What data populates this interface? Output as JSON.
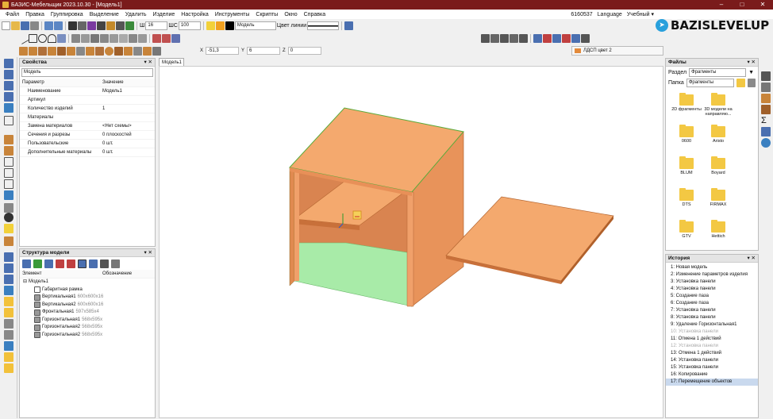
{
  "window": {
    "title": "БАЗИС-Мебельщик 2023.10.30 - [Модель1]",
    "min": "–",
    "max": "□",
    "close": "✕"
  },
  "menu": [
    "Файл",
    "Правка",
    "Группировка",
    "Выделение",
    "Удалить",
    "Изделие",
    "Настройка",
    "Инструменты",
    "Скрипты",
    "Окно",
    "Справка"
  ],
  "menu_right": {
    "id": "6160537",
    "language": "Language",
    "mode": "Учебный ▾"
  },
  "toolbar": {
    "width_label": "Ш",
    "width_value": "16",
    "step_label": "ШС",
    "step_value": "100",
    "layer_value": "Модель",
    "line_color_label": "Цвет линии"
  },
  "brand": {
    "text": "BAZISLEVELUP",
    "tg_icon": "telegram-icon"
  },
  "coords": {
    "x_label": "X",
    "x_value": "-51,3",
    "y_label": "Y",
    "y_value": "6",
    "z_label": "Z",
    "z_value": "0"
  },
  "material": "ЛДСП цвет 2",
  "doc_tab": "Модель1",
  "properties": {
    "title": "Свойства",
    "controls": "▾ ✕",
    "selector": "Модель",
    "col_param": "Параметр",
    "col_value": "Значение",
    "rows": [
      {
        "k": "Наименование",
        "v": "Модель1"
      },
      {
        "k": "Артикул",
        "v": ""
      },
      {
        "k": "Количество изделий",
        "v": "1"
      },
      {
        "k": "Материалы",
        "v": ""
      },
      {
        "k": "Замена материалов",
        "v": "<Нет схемы>"
      },
      {
        "k": "Сечения и разрезы",
        "v": "0 плоскостей"
      },
      {
        "k": "Пользовательские",
        "v": "0 шт."
      },
      {
        "k": "Дополнительные материалы",
        "v": "0 шт."
      }
    ]
  },
  "structure": {
    "title": "Структура модели",
    "controls": "▾ ✕",
    "col_element": "Элемент",
    "col_name": "Обозначение",
    "root": "Модель1",
    "items": [
      {
        "name": "Габаритная рамка",
        "size": ""
      },
      {
        "name": "Вертикальная1",
        "size": "600x600x16"
      },
      {
        "name": "Вертикальная2",
        "size": "600x600x16"
      },
      {
        "name": "Фронтальная1",
        "size": "597x585x4"
      },
      {
        "name": "Горизонтальная1",
        "size": "568x595x"
      },
      {
        "name": "Горизонтальная2",
        "size": "568x595x"
      },
      {
        "name": "Горизонтальная2",
        "size": "568x595x"
      }
    ]
  },
  "files": {
    "title": "Файлы",
    "controls": "▾ ✕",
    "section_label": "Раздел",
    "section_value": "Фрагменты",
    "folder_label": "Папка",
    "folder_value": "Фрагменты",
    "folders": [
      "2D фрагменты",
      "3D модели на направляю...",
      "0600",
      "Aristo",
      "BLUM",
      "Boyard",
      "DTS",
      "FIRMAX",
      "GTV",
      "Hettich"
    ]
  },
  "history": {
    "title": "История",
    "controls": "▾ ✕",
    "items": [
      {
        "t": "1:  Новая модель",
        "s": "n"
      },
      {
        "t": "2:  Изменение параметров изделия",
        "s": "n"
      },
      {
        "t": "3:  Установка панели",
        "s": "n"
      },
      {
        "t": "4:  Установка панели",
        "s": "n"
      },
      {
        "t": "5:  Создание паза",
        "s": "n"
      },
      {
        "t": "6:  Создание паза",
        "s": "n"
      },
      {
        "t": "7:  Установка панели",
        "s": "n"
      },
      {
        "t": "8:  Установка панели",
        "s": "n"
      },
      {
        "t": "9:  Удаление Горизонтальная1",
        "s": "n"
      },
      {
        "t": "10: Установка панели",
        "s": "dis"
      },
      {
        "t": "11: Отмена 1 действий",
        "s": "n"
      },
      {
        "t": "12: Установка панели",
        "s": "dis"
      },
      {
        "t": "13: Отмена 1 действий",
        "s": "n"
      },
      {
        "t": "14: Установка панели",
        "s": "n"
      },
      {
        "t": "15: Установка панели",
        "s": "n"
      },
      {
        "t": "16: Копирование",
        "s": "n"
      },
      {
        "t": "17: Перемещение объектов",
        "s": "sel"
      }
    ]
  },
  "colors": {
    "title_bar": "#7a1b1b",
    "panel_face": "#f4a96e",
    "panel_side": "#e08a50",
    "panel_edge": "#c8703a",
    "highlight": "#a8eba8",
    "accent": "#28a0dc"
  }
}
